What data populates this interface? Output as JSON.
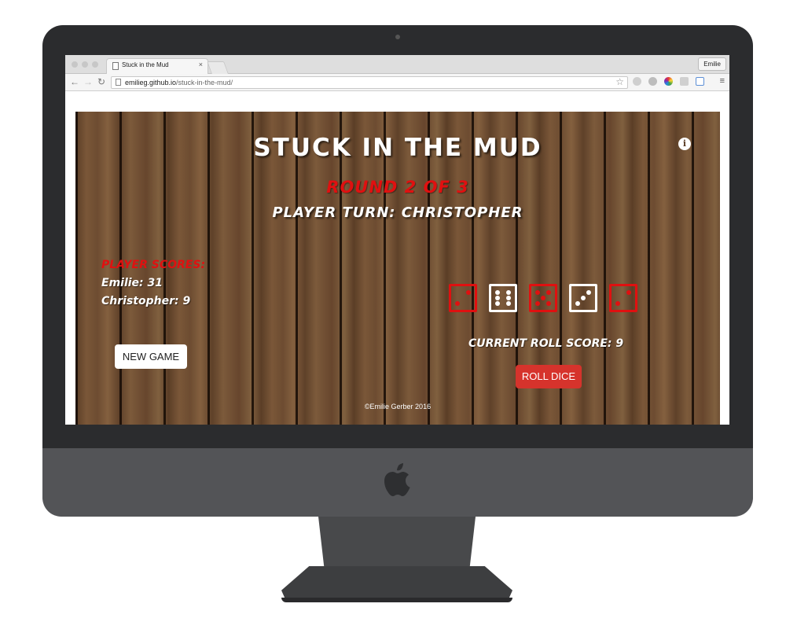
{
  "browser": {
    "tab_title": "Stuck in the Mud",
    "tab_close": "×",
    "profile_name": "Emilie",
    "url_host": "emilieg.github.io",
    "url_path": "/stuck-in-the-mud/",
    "nav": {
      "back": "←",
      "forward": "→",
      "reload": "↻"
    },
    "bookmark_star": "☆",
    "menu": "≡"
  },
  "game": {
    "title": "Stuck in the Mud",
    "round": "Round 2 of 3",
    "turn": "Player Turn: Christopher",
    "info": "i",
    "scores_heading": "Player Scores:",
    "players": [
      {
        "label": "Emilie: 31"
      },
      {
        "label": "Christopher: 9"
      }
    ],
    "new_game_label": "NEW GAME",
    "roll_score": "Current Roll Score: 9",
    "roll_button_label": "ROLL DICE",
    "dice": [
      {
        "value": 2,
        "color": "#e01010"
      },
      {
        "value": 6,
        "color": "#ffffff"
      },
      {
        "value": 5,
        "color": "#e01010"
      },
      {
        "value": 3,
        "color": "#ffffff"
      },
      {
        "value": 2,
        "color": "#e01010"
      }
    ],
    "footer": "©Emilie Gerber 2016"
  },
  "colors": {
    "accent_red": "#e01010",
    "roll_button": "#d6332c",
    "wood": "#6b4a30"
  }
}
